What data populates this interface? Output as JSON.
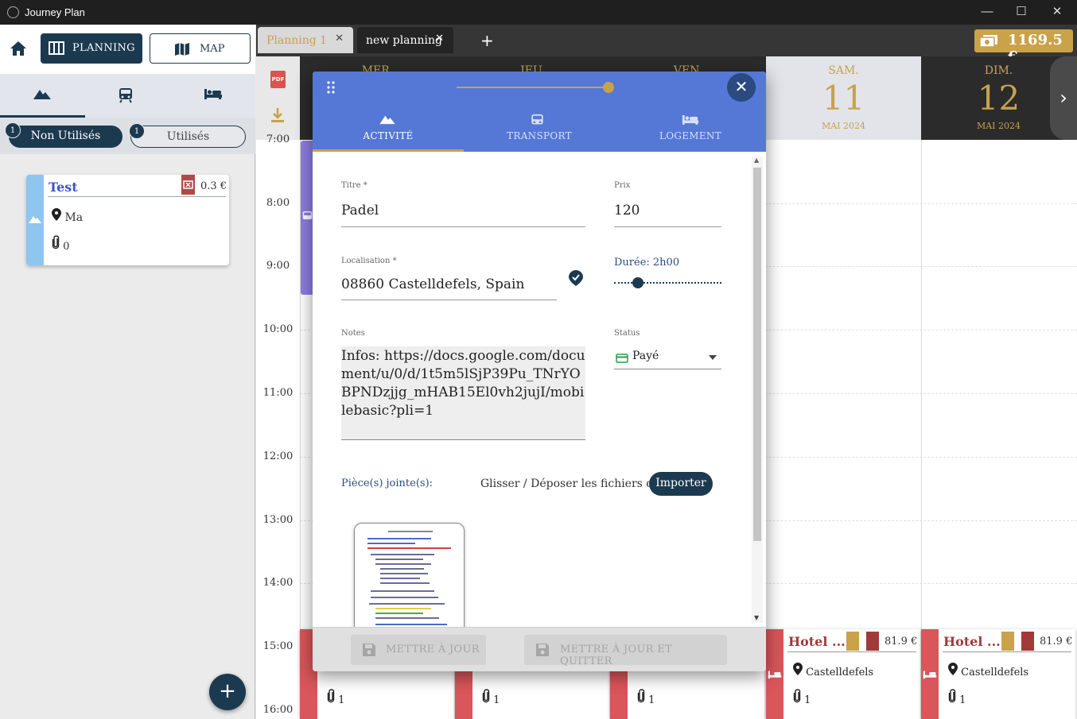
{
  "window": {
    "title": "Journey Plan",
    "minimize": "—",
    "maximize": "☐",
    "close": "✕"
  },
  "sidebar": {
    "nav": {
      "planning_label": "PLANNING",
      "map_label": "MAP"
    },
    "filters": {
      "unused_label": "Non Utilisés",
      "unused_count": "1",
      "used_label": "Utilisés",
      "used_count": "1"
    },
    "card": {
      "title": "Test",
      "price": "0.3 €",
      "location": "Ma",
      "attachments": "0"
    },
    "fab": "+"
  },
  "tabs": [
    {
      "label": "Planning 1",
      "close": "✕"
    },
    {
      "label": "new planning",
      "close": "✕"
    }
  ],
  "add_tab": "+",
  "budget": "1169.5 €",
  "calendar": {
    "days": [
      {
        "name": "MER.",
        "num": "",
        "month": ""
      },
      {
        "name": "JEU.",
        "num": "",
        "month": ""
      },
      {
        "name": "VEN.",
        "num": "",
        "month": ""
      },
      {
        "name": "SAM.",
        "num": "11",
        "month": "MAI 2024"
      },
      {
        "name": "DIM.",
        "num": "12",
        "month": "MAI 2024"
      }
    ],
    "hours": [
      "7:00",
      "8:00",
      "9:00",
      "10:00",
      "11:00",
      "12:00",
      "13:00",
      "14:00",
      "15:00",
      "16:00"
    ],
    "next": "›",
    "hotels": [
      {
        "title": "Hotel ...",
        "price": "81.9 €",
        "location": "Castelldefels",
        "attachments": "1"
      },
      {
        "title": "Hotel ...",
        "price": "81.9 €",
        "location": "Castelldefels",
        "attachments": "1"
      }
    ],
    "hidden_hotels": [
      {
        "attachments": "1"
      },
      {
        "attachments": "1"
      },
      {
        "attachments": "1"
      }
    ]
  },
  "modal": {
    "close": "✕",
    "tabs": {
      "activity": "ACTIVITÉ",
      "transport": "TRANSPORT",
      "lodging": "LOGEMENT"
    },
    "form": {
      "title_label": "Titre *",
      "title_value": "Padel",
      "price_label": "Prix",
      "price_value": "120",
      "location_label": "Localisation *",
      "location_value": "08860 Castelldefels, Spain",
      "duration_label": "Durée: 2h00",
      "notes_label": "Notes",
      "notes_value": "Infos: https://docs.google.com/document/u/0/d/1t5m5lSjP39Pu_TNrYOBPNDzjjg_mHAB15El0vh2jujI/mobilebasic?pli=1",
      "status_label": "Status",
      "status_value": "Payé",
      "attachments_label": "Pièce(s) jointe(s):",
      "drop_text": "Glisser / Déposer les fichiers ou",
      "import_label": "Importer"
    },
    "footer": {
      "update": "METTRE À JOUR",
      "update_quit": "METTRE À JOUR ET QUITTER"
    }
  }
}
